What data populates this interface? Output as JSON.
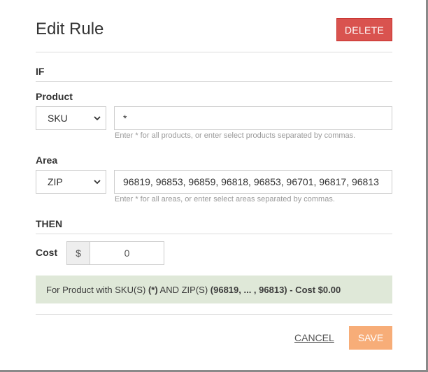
{
  "dialog": {
    "title": "Edit Rule",
    "delete_label": "DELETE",
    "cancel_label": "CANCEL",
    "save_label": "SAVE"
  },
  "if_section": {
    "heading": "IF",
    "product": {
      "label": "Product",
      "type_selected": "SKU",
      "value": "*",
      "help": "Enter * for all products, or enter select products separated by commas."
    },
    "area": {
      "label": "Area",
      "type_selected": "ZIP",
      "value": "96819, 96853, 96859, 96818, 96853, 96701, 96817, 96813",
      "help": "Enter * for all areas, or enter select areas separated by commas."
    }
  },
  "then_section": {
    "heading": "THEN",
    "cost": {
      "label": "Cost",
      "currency_symbol": "$",
      "value": "0"
    }
  },
  "summary": {
    "prefix": "For Product with SKU(S) ",
    "product_value": "(*)",
    "middle": " AND ZIP(S) ",
    "area_value": "(96819, ... , 96813) - Cost $0.00"
  },
  "colors": {
    "delete_button": "#d9534f",
    "save_button": "#f7ad78",
    "summary_background": "#dfe8d8"
  }
}
